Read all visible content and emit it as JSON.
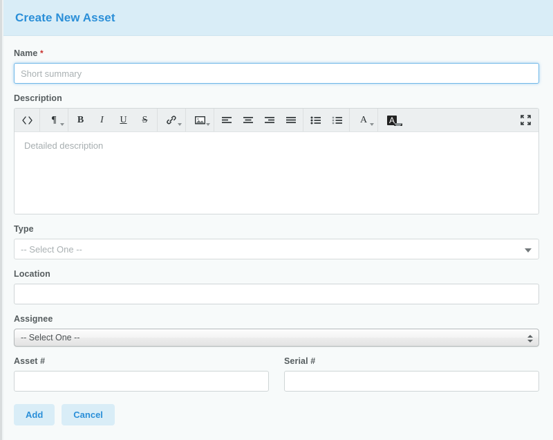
{
  "header": {
    "title": "Create New Asset"
  },
  "form": {
    "name": {
      "label": "Name",
      "required_marker": "*",
      "placeholder": "Short summary",
      "value": ""
    },
    "description": {
      "label": "Description",
      "placeholder": "Detailed description",
      "value": "",
      "toolbar": {
        "groups": [
          {
            "buttons": [
              {
                "name": "code-view-icon",
                "glyph": "<>",
                "caret": false
              }
            ]
          },
          {
            "buttons": [
              {
                "name": "paragraph-format-icon",
                "glyph": "¶",
                "caret": true
              }
            ]
          },
          {
            "buttons": [
              {
                "name": "bold-icon",
                "glyph": "B",
                "caret": false
              },
              {
                "name": "italic-icon",
                "glyph": "I",
                "caret": false
              },
              {
                "name": "underline-icon",
                "glyph": "U",
                "caret": false
              },
              {
                "name": "strikethrough-icon",
                "glyph": "S",
                "caret": false
              }
            ]
          },
          {
            "buttons": [
              {
                "name": "link-icon",
                "glyph": "link",
                "caret": true
              }
            ]
          },
          {
            "buttons": [
              {
                "name": "image-icon",
                "glyph": "image",
                "caret": true
              }
            ]
          },
          {
            "buttons": [
              {
                "name": "align-left-icon",
                "glyph": "align-left",
                "caret": false
              },
              {
                "name": "align-center-icon",
                "glyph": "align-center",
                "caret": false
              },
              {
                "name": "align-right-icon",
                "glyph": "align-right",
                "caret": false
              },
              {
                "name": "align-justify-icon",
                "glyph": "align-justify",
                "caret": false
              }
            ]
          },
          {
            "buttons": [
              {
                "name": "unordered-list-icon",
                "glyph": "ul",
                "caret": false
              },
              {
                "name": "ordered-list-icon",
                "glyph": "ol",
                "caret": false
              }
            ]
          },
          {
            "buttons": [
              {
                "name": "text-color-icon",
                "glyph": "A",
                "caret": true
              }
            ]
          },
          {
            "buttons": [
              {
                "name": "background-color-icon",
                "glyph": "A-boxed",
                "caret": true
              }
            ]
          },
          {
            "buttons": [
              {
                "name": "fullscreen-icon",
                "glyph": "expand",
                "caret": false
              }
            ]
          }
        ]
      }
    },
    "type": {
      "label": "Type",
      "selected": "-- Select One --"
    },
    "location": {
      "label": "Location",
      "value": "",
      "placeholder": ""
    },
    "assignee": {
      "label": "Assignee",
      "selected": "-- Select One --"
    },
    "asset_number": {
      "label": "Asset #",
      "value": "",
      "placeholder": ""
    },
    "serial_number": {
      "label": "Serial #",
      "value": "",
      "placeholder": ""
    }
  },
  "actions": {
    "submit_label": "Add",
    "cancel_label": "Cancel"
  },
  "colors": {
    "accent": "#2b8fd8",
    "header_bg": "#d9edf7",
    "page_bg": "#f7fafa",
    "required": "#c9302c",
    "toolbar_bg": "#eceff0"
  }
}
